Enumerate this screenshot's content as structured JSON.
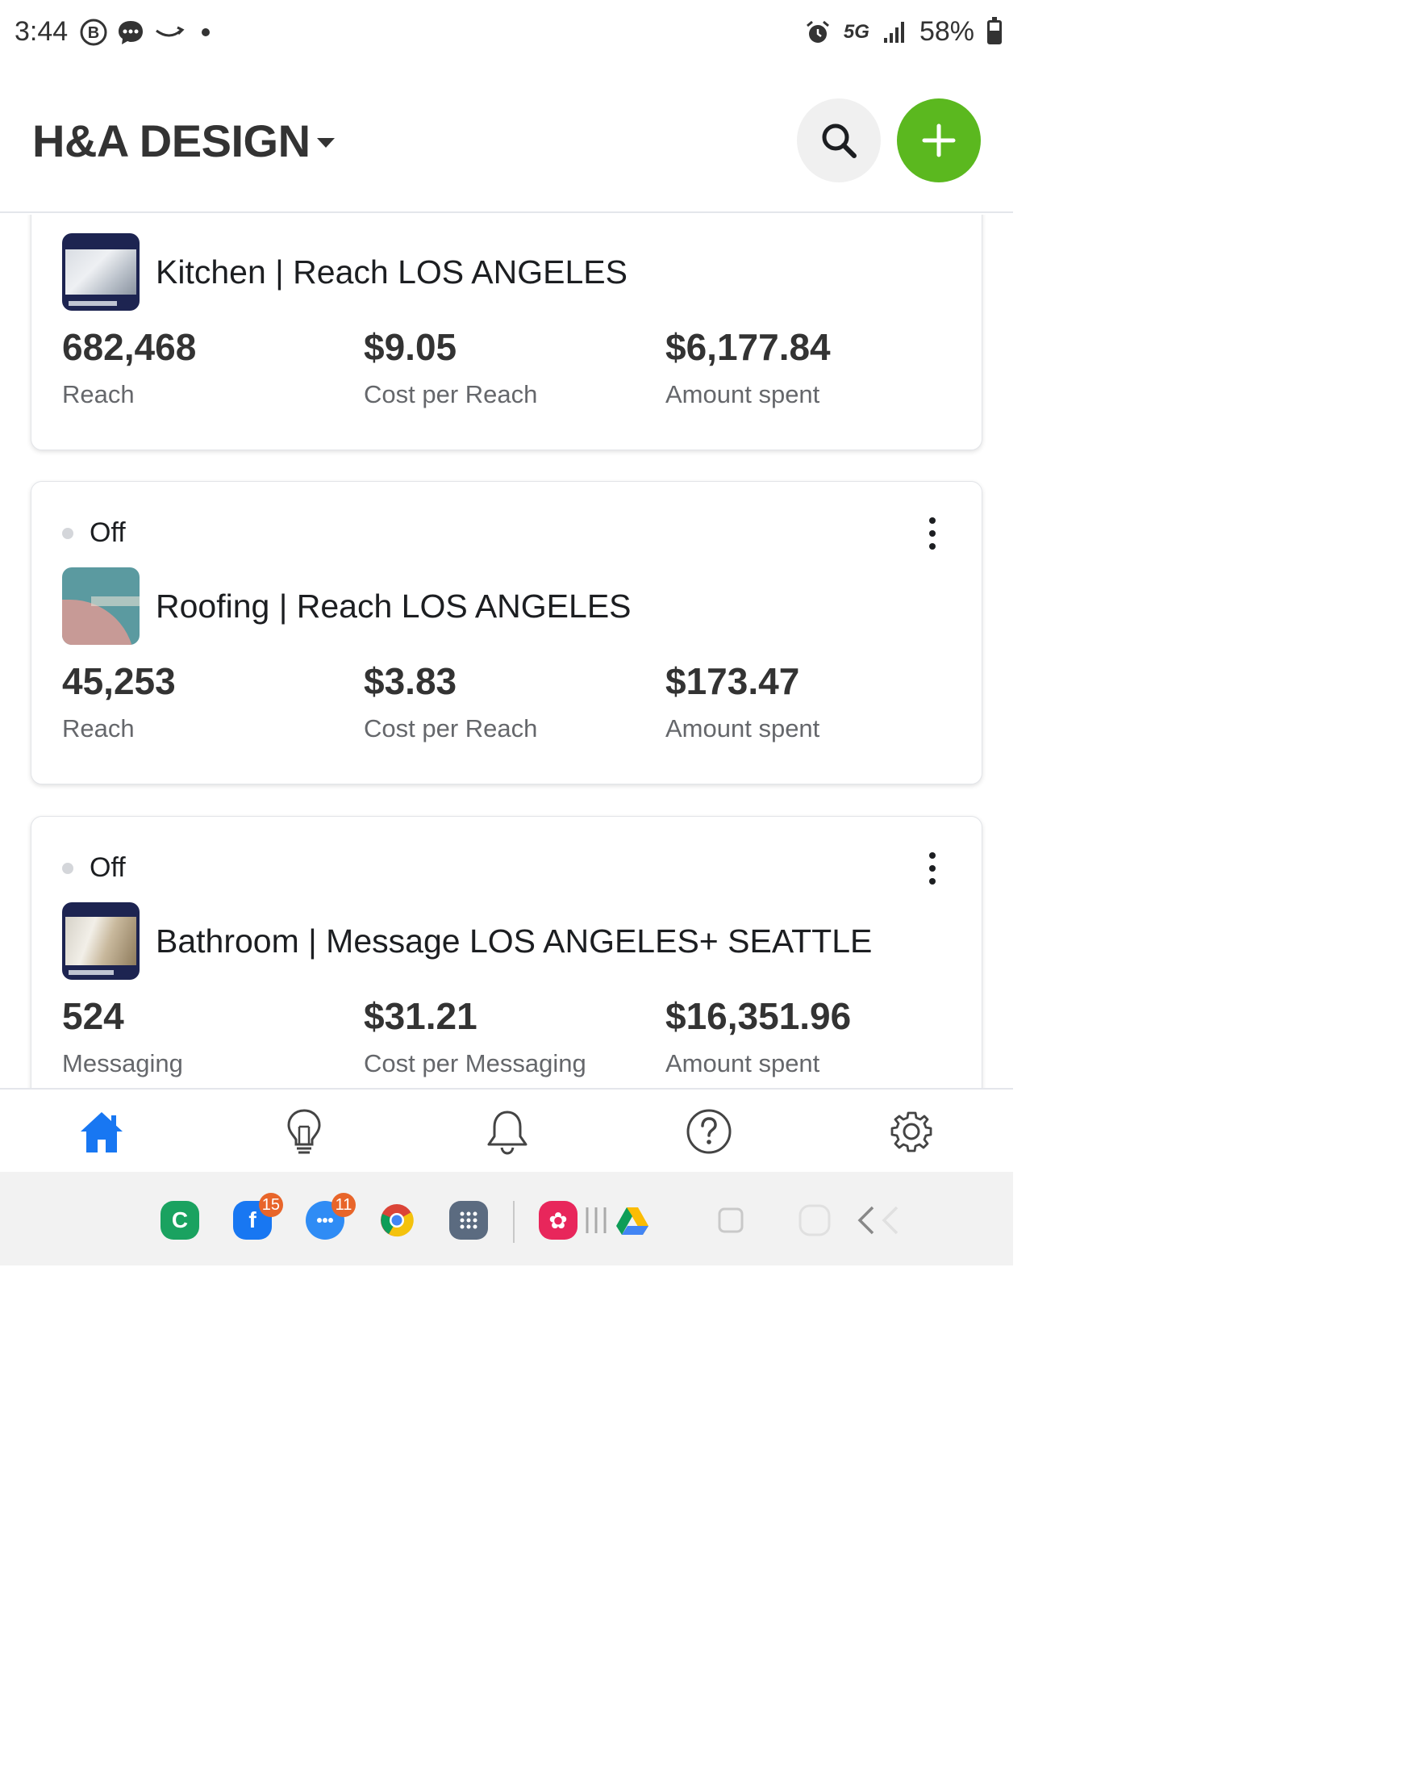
{
  "status_bar": {
    "time": "3:44",
    "network": "5G",
    "battery": "58%",
    "left_icons": [
      "b-circle-icon",
      "chat-bubble-icon",
      "amazon-smile-icon",
      "dot-icon"
    ],
    "right_icons": [
      "alarm-icon",
      "signal-icon",
      "battery-icon"
    ]
  },
  "header": {
    "account_name": "H&A DESIGN",
    "search_icon": "search-icon",
    "add_icon": "plus-icon",
    "add_color": "#5bb81f"
  },
  "campaigns": [
    {
      "name": "Kitchen | Reach LOS ANGELES",
      "metrics": [
        {
          "value": "682,468",
          "label": "Reach"
        },
        {
          "value": "$9.05",
          "label": "Cost per Reach"
        },
        {
          "value": "$6,177.84",
          "label": "Amount spent"
        }
      ]
    },
    {
      "status": "Off",
      "name": "Roofing | Reach LOS ANGELES",
      "metrics": [
        {
          "value": "45,253",
          "label": "Reach"
        },
        {
          "value": "$3.83",
          "label": "Cost per Reach"
        },
        {
          "value": "$173.47",
          "label": "Amount spent"
        }
      ]
    },
    {
      "status": "Off",
      "name": "Bathroom | Message LOS ANGELES+ SEATTLE",
      "metrics": [
        {
          "value": "524",
          "label": "Messaging"
        },
        {
          "value": "$31.21",
          "label": "Cost per Messaging"
        },
        {
          "value": "$16,351.96",
          "label": "Amount spent"
        }
      ]
    }
  ],
  "bottom_nav": {
    "items": [
      "home-icon",
      "lightbulb-icon",
      "bell-icon",
      "help-icon",
      "settings-icon"
    ],
    "active": "home-icon",
    "active_color": "#1877f2"
  },
  "system_dock": {
    "apps": [
      {
        "icon": "c-app-icon",
        "badge": ""
      },
      {
        "icon": "facebook-icon",
        "badge": "15"
      },
      {
        "icon": "messages-icon",
        "badge": "11"
      },
      {
        "icon": "chrome-icon",
        "badge": ""
      },
      {
        "icon": "app-drawer-icon",
        "badge": ""
      },
      {
        "icon": "flower-app-icon",
        "badge": ""
      },
      {
        "icon": "drive-icon",
        "badge": ""
      }
    ]
  }
}
